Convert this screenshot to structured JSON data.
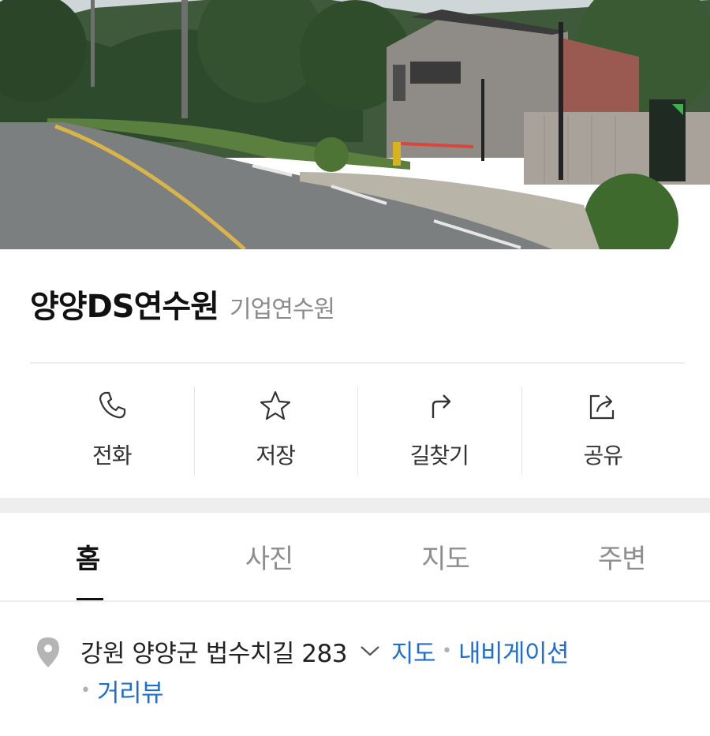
{
  "place": {
    "name": "양양DS연수원",
    "category": "기업연수원"
  },
  "actions": [
    {
      "label": "전화",
      "icon": "phone-icon"
    },
    {
      "label": "저장",
      "icon": "star-icon"
    },
    {
      "label": "길찾기",
      "icon": "directions-icon"
    },
    {
      "label": "공유",
      "icon": "share-icon"
    }
  ],
  "tabs": [
    {
      "label": "홈",
      "active": true
    },
    {
      "label": "사진",
      "active": false
    },
    {
      "label": "지도",
      "active": false
    },
    {
      "label": "주변",
      "active": false
    }
  ],
  "address": {
    "text": "강원 양양군 법수치길 283",
    "links": {
      "map": "지도",
      "navigation": "내비게이션",
      "street_view": "거리뷰"
    },
    "separator": "•"
  },
  "colors": {
    "link": "#1f6fd1",
    "active_tab": "#111111",
    "inactive_tab": "#8e8e8e",
    "category": "#8b8b8b"
  }
}
